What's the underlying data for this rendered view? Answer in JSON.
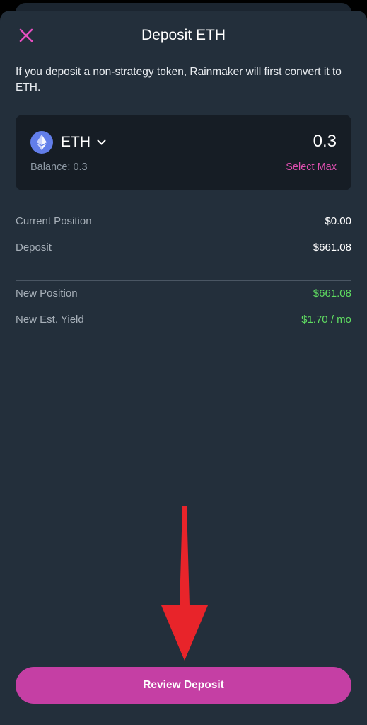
{
  "header": {
    "title": "Deposit ETH",
    "close_icon": "close-icon"
  },
  "notice": "If you deposit a non-strategy token, Rainmaker will first convert it to ETH.",
  "token_card": {
    "symbol": "ETH",
    "logo_icon": "ethereum-icon",
    "amount": "0.3",
    "balance": "Balance: 0.3",
    "select_max": "Select Max"
  },
  "summary": {
    "current_position_label": "Current Position",
    "current_position_value": "$0.00",
    "deposit_label": "Deposit",
    "deposit_value": "$661.08",
    "new_position_label": "New Position",
    "new_position_value": "$661.08",
    "new_yield_label": "New Est. Yield",
    "new_yield_value": "$1.70 / mo"
  },
  "actions": {
    "review_deposit": "Review Deposit"
  },
  "colors": {
    "accent": "#c53fa4",
    "close": "#e54fc0",
    "select_max": "#df4fb0",
    "positive": "#5fdb61",
    "annotation_arrow": "#e8242a",
    "sheet": "#232f3b",
    "card": "#161d25"
  }
}
